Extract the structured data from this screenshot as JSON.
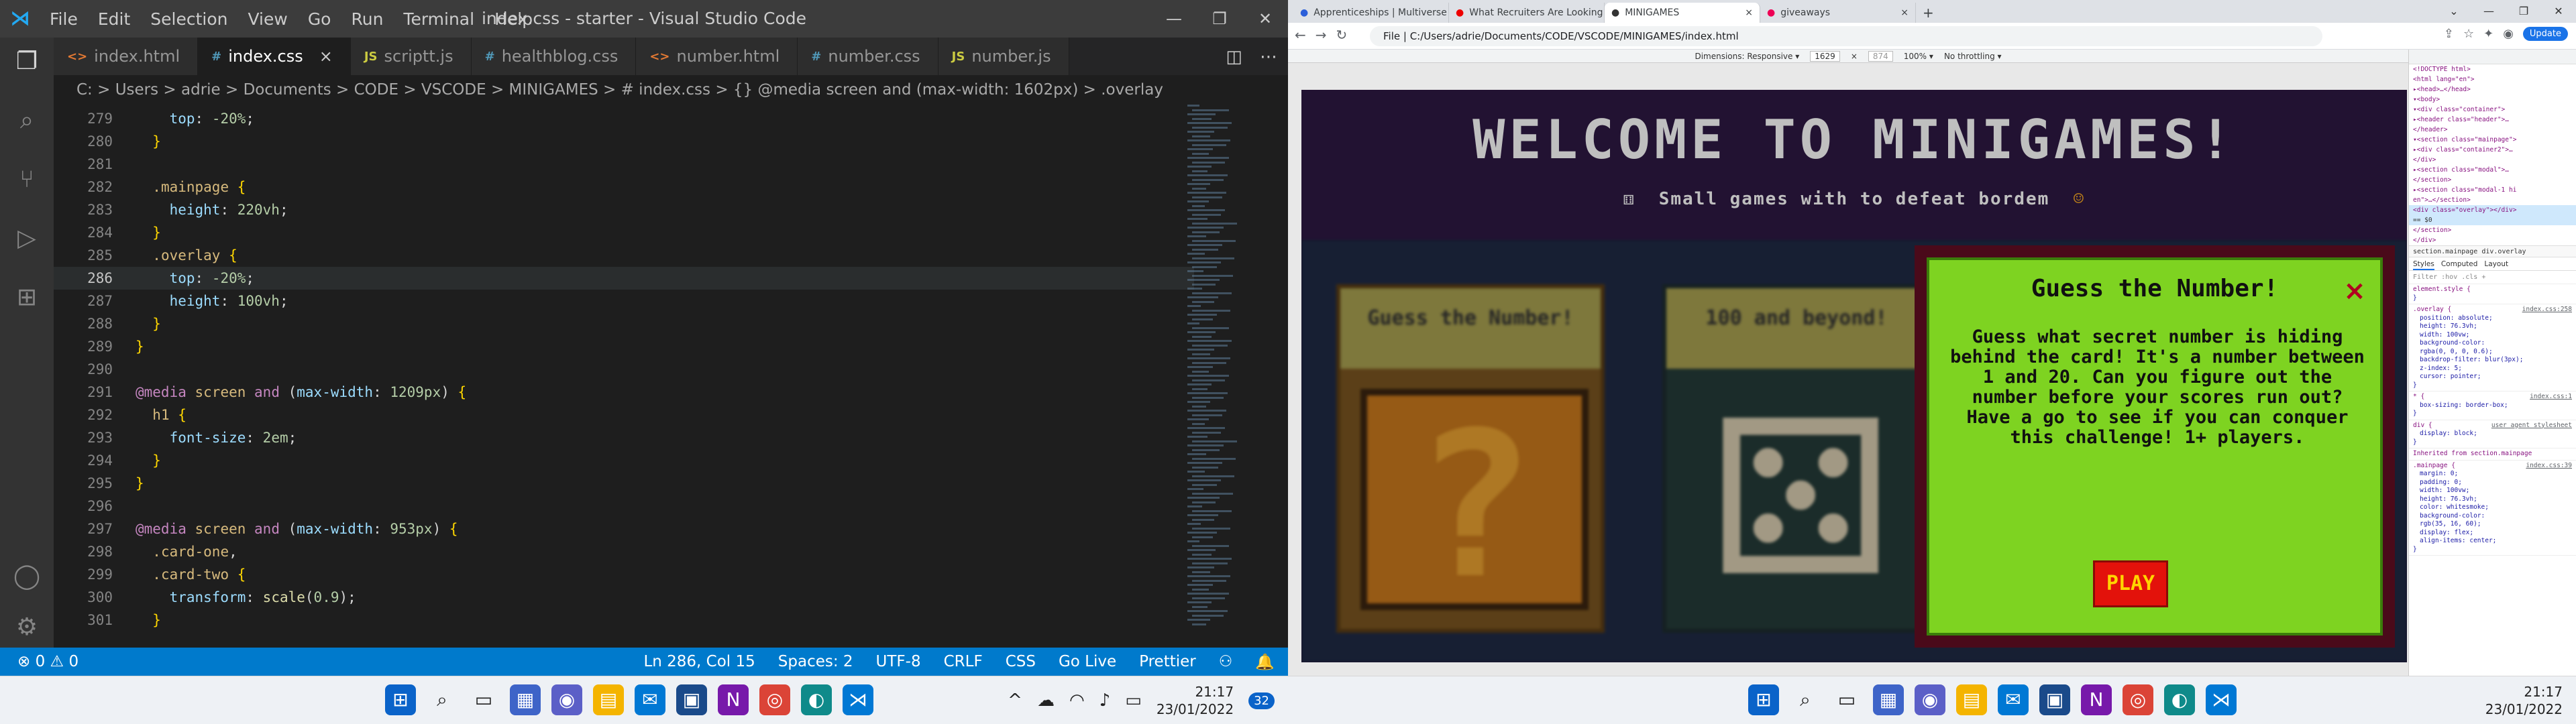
{
  "vscode": {
    "window_title": "index.css - starter - Visual Studio Code",
    "menu": [
      "File",
      "Edit",
      "Selection",
      "View",
      "Go",
      "Run",
      "Terminal",
      "Help"
    ],
    "tabs": [
      {
        "label": "index.html",
        "icon": "<>",
        "color": "#e37933",
        "active": false
      },
      {
        "label": "index.css",
        "icon": "#",
        "color": "#519aba",
        "active": true
      },
      {
        "label": "scriptt.js",
        "icon": "JS",
        "color": "#cbcb41",
        "active": false
      },
      {
        "label": "healthblog.css",
        "icon": "#",
        "color": "#519aba",
        "active": false
      },
      {
        "label": "number.html",
        "icon": "<>",
        "color": "#e37933",
        "active": false
      },
      {
        "label": "number.css",
        "icon": "#",
        "color": "#519aba",
        "active": false
      },
      {
        "label": "number.js",
        "icon": "JS",
        "color": "#cbcb41",
        "active": false
      }
    ],
    "breadcrumb": "C: > Users > adrie > Documents > CODE > VSCODE > MINIGAMES > # index.css > {} @media screen and (max-width: 1602px) > .overlay",
    "code_lines": [
      {
        "n": "279",
        "html": "    <span class='k-prop'>top</span>: <span class='k-num'>-20%</span>;"
      },
      {
        "n": "280",
        "html": "  <span class='k-curly'>}</span>"
      },
      {
        "n": "281",
        "html": ""
      },
      {
        "n": "282",
        "html": "  <span class='k-sel'>.mainpage</span> <span class='k-curly'>{</span>"
      },
      {
        "n": "283",
        "html": "    <span class='k-prop'>height</span>: <span class='k-num'>220vh</span>;"
      },
      {
        "n": "284",
        "html": "  <span class='k-curly'>}</span>"
      },
      {
        "n": "285",
        "html": "  <span class='k-sel'>.overlay</span> <span class='k-curly'>{</span>"
      },
      {
        "n": "286",
        "html": "    <span class='k-prop'>top</span>: <span class='k-num'>-20%</span>;",
        "current": true
      },
      {
        "n": "287",
        "html": "    <span class='k-prop'>height</span>: <span class='k-num'>100vh</span>;"
      },
      {
        "n": "288",
        "html": "  <span class='k-curly'>}</span>"
      },
      {
        "n": "289",
        "html": "<span class='k-curly'>}</span>"
      },
      {
        "n": "290",
        "html": ""
      },
      {
        "n": "291",
        "html": "<span class='k-at'>@media</span> <span class='k-sel'>screen</span> <span class='k-kw'>and</span> (<span class='k-prop'>max-width</span>: <span class='k-num'>1209px</span>) <span class='k-curly'>{</span>"
      },
      {
        "n": "292",
        "html": "  <span class='k-sel'>h1</span> <span class='k-curly'>{</span>"
      },
      {
        "n": "293",
        "html": "    <span class='k-prop'>font-size</span>: <span class='k-num'>2em</span>;"
      },
      {
        "n": "294",
        "html": "  <span class='k-curly'>}</span>"
      },
      {
        "n": "295",
        "html": "<span class='k-curly'>}</span>"
      },
      {
        "n": "296",
        "html": ""
      },
      {
        "n": "297",
        "html": "<span class='k-at'>@media</span> <span class='k-sel'>screen</span> <span class='k-kw'>and</span> (<span class='k-prop'>max-width</span>: <span class='k-num'>953px</span>) <span class='k-curly'>{</span>"
      },
      {
        "n": "298",
        "html": "  <span class='k-sel'>.card-one</span>,"
      },
      {
        "n": "299",
        "html": "  <span class='k-sel'>.card-two</span> <span class='k-curly'>{</span>"
      },
      {
        "n": "300",
        "html": "    <span class='k-prop'>transform</span>: <span class='k-fn'>scale</span>(<span class='k-num'>0.9</span>);"
      },
      {
        "n": "301",
        "html": "  <span class='k-curly'>}</span>"
      }
    ],
    "status_left": "⊗ 0 ⚠ 0",
    "status_right": [
      "Ln 286, Col 15",
      "Spaces: 2",
      "UTF-8",
      "CRLF",
      "CSS",
      "Go Live",
      "Prettier"
    ]
  },
  "taskbar_left": {
    "time": "21:17",
    "date": "23/01/2022",
    "badge": "32"
  },
  "browser": {
    "tabs": [
      {
        "label": "Apprenticeships | Multiverse",
        "active": false
      },
      {
        "label": "What Recruiters Are Looking for",
        "active": false
      },
      {
        "label": "MINIGAMES",
        "active": true
      },
      {
        "label": "giveaways",
        "active": false
      }
    ],
    "url": "File  |  C:/Users/adrie/Documents/CODE/VSCODE/MINIGAMES/index.html",
    "update_label": "Update",
    "devbar": {
      "dimensions": "Dimensions: Responsive ▾",
      "width": "1629",
      "height": "874",
      "zoom": "100% ▾",
      "throttle": "No throttling ▾"
    },
    "page": {
      "title": "WELCOME TO MINIGAMES!",
      "subtitle": "Small games with to defeat bordem",
      "card1_title": "Guess the Number!",
      "card2_title": "100 and beyond!",
      "modal": {
        "title": "Guess the Number!",
        "text": "Guess what secret number is hiding behind the card! It's a number between 1 and 20. Can you figure out the number before your scores run out? Have a go to see if you can conquer this challenge! 1+ players.",
        "play": "PLAY",
        "close": "×"
      }
    },
    "devtools": {
      "dom_lines": [
        "<!DOCTYPE html>",
        "<html lang=\"en\">",
        "▸<head>…</head>",
        "▾<body>",
        "  ▾<div class=\"container\">",
        "    ▸<header class=\"header\">…",
        "    </header>",
        "    ▾<section class=\"mainpage\">",
        "      ▸<div class=\"container2\">…",
        "      </div>",
        "      ▸<section class=\"modal\">…",
        "      </section>",
        "      ▸<section class=\"modal-1 hi",
        "      en\">…</section>",
        "      <div class=\"overlay\"></div>",
        "      == $0",
        "    </section>",
        "  </div>"
      ],
      "crumbs": "section.mainpage   div.overlay",
      "tabs": [
        "Styles",
        "Computed",
        "Layout"
      ],
      "filter": "Filter            :hov  .cls  +",
      "rules": [
        {
          "sel": "element.style {",
          "src": "",
          "props": [
            "}"
          ]
        },
        {
          "sel": ".overlay {",
          "src": "index.css:258",
          "props": [
            "position: absolute;",
            "height: 76.3vh;",
            "width: 100vw;",
            "background-color:",
            "  rgba(0, 0, 0, 0.6);",
            "backdrop-filter: blur(3px);",
            "z-index: 5;",
            "cursor: pointer;",
            "}"
          ]
        },
        {
          "sel": "* {",
          "src": "index.css:1",
          "props": [
            "box-sizing: border-box;",
            "}"
          ]
        },
        {
          "sel": "div {",
          "src": "user agent stylesheet",
          "props": [
            "display: block;",
            "}"
          ]
        },
        {
          "sel": "Inherited from section.mainpage",
          "src": "",
          "props": []
        },
        {
          "sel": ".mainpage {",
          "src": "index.css:39",
          "props": [
            "margin: 0;",
            "padding: 0;",
            "width: 100vw;",
            "height: 76.3vh;",
            "color: whitesmoke;",
            "background-color:",
            "  rgb(35, 16, 60);",
            "display: flex;",
            "align-items: center;",
            "}"
          ]
        }
      ]
    }
  },
  "taskbar_right": {
    "time": "21:17",
    "date": "23/01/2022"
  }
}
